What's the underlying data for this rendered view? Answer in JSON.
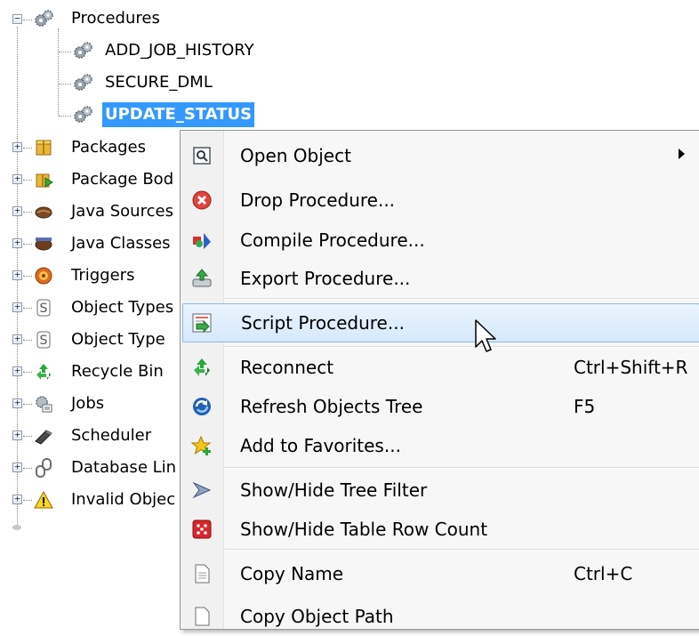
{
  "tree": {
    "procedures_label": "Procedures",
    "procedure_items": [
      "ADD_JOB_HISTORY",
      "SECURE_DML",
      "UPDATE_STATUS"
    ],
    "nodes": [
      {
        "label": "Packages",
        "icon": "package-icon"
      },
      {
        "label": "Package Bod",
        "icon": "package-body-icon"
      },
      {
        "label": "Java Sources",
        "icon": "java-source-icon"
      },
      {
        "label": "Java Classes",
        "icon": "java-class-icon"
      },
      {
        "label": "Triggers",
        "icon": "trigger-icon"
      },
      {
        "label": "Object Types",
        "icon": "object-type-icon"
      },
      {
        "label": "Object Type",
        "icon": "object-type-body-icon"
      },
      {
        "label": "Recycle Bin",
        "icon": "recycle-bin-icon"
      },
      {
        "label": "Jobs",
        "icon": "jobs-icon"
      },
      {
        "label": "Scheduler",
        "icon": "scheduler-icon"
      },
      {
        "label": "Database Lin",
        "icon": "database-link-icon"
      },
      {
        "label": "Invalid Objec",
        "icon": "warning-icon"
      }
    ]
  },
  "menu": {
    "items": [
      {
        "label": "Open Object",
        "shortcut": "",
        "icon": "open-object-icon",
        "submenu": true
      },
      {
        "label": "Drop Procedure...",
        "shortcut": "",
        "icon": "drop-icon"
      },
      {
        "label": "Compile Procedure...",
        "shortcut": "",
        "icon": "compile-icon"
      },
      {
        "label": "Export Procedure...",
        "shortcut": "",
        "icon": "export-icon"
      },
      {
        "label": "Script Procedure...",
        "shortcut": "",
        "icon": "script-icon",
        "highlighted": true
      },
      {
        "label": "Reconnect",
        "shortcut": "Ctrl+Shift+R",
        "icon": "reconnect-icon"
      },
      {
        "label": "Refresh Objects Tree",
        "shortcut": "F5",
        "icon": "refresh-icon"
      },
      {
        "label": "Add to Favorites...",
        "shortcut": "",
        "icon": "favorites-icon"
      },
      {
        "label": "Show/Hide Tree Filter",
        "shortcut": "",
        "icon": "filter-icon"
      },
      {
        "label": "Show/Hide Table Row Count",
        "shortcut": "",
        "icon": "row-count-icon"
      },
      {
        "label": "Copy Name",
        "shortcut": "Ctrl+C",
        "icon": "copy-name-icon"
      },
      {
        "label": "Copy Object Path",
        "shortcut": "",
        "icon": "copy-path-icon"
      }
    ]
  },
  "colors": {
    "selection": "#3399ff",
    "menu_highlight": "#d6e9fb",
    "menu_bg": "#f7f7f7"
  }
}
